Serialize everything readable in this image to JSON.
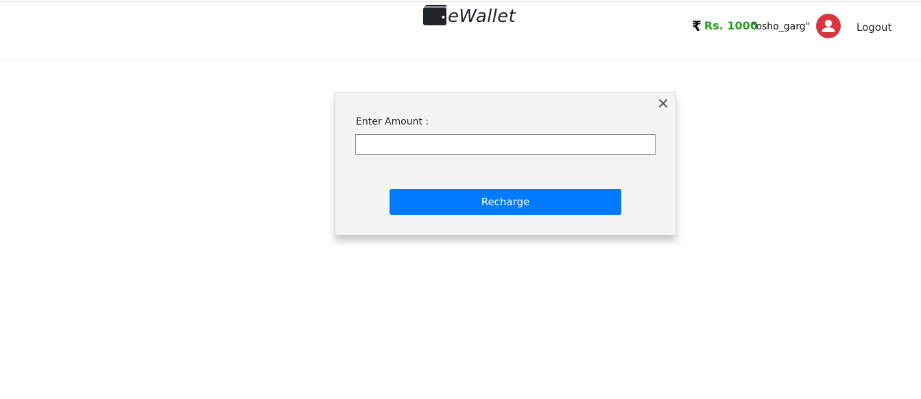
{
  "header": {
    "brand": "eWallet",
    "brand_icon": "wallet-icon",
    "balance_icon": "rupee-icon",
    "balance_symbol": "₹",
    "balance": "Rs. 1000",
    "username": "\"osho_garg\"",
    "avatar_icon": "user-icon",
    "logout_label": "Logout"
  },
  "modal": {
    "close_icon": "close-icon",
    "amount_label": "Enter Amount :",
    "amount_value": "",
    "amount_placeholder": "",
    "recharge_label": "Recharge"
  },
  "colors": {
    "balance_green": "#21a11f",
    "primary_blue": "#007bff",
    "avatar_red": "#d9353f",
    "modal_bg": "#f4f4f4"
  }
}
